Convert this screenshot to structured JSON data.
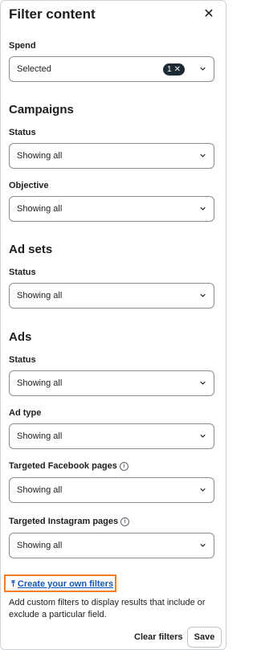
{
  "header": {
    "title": "Filter content",
    "close_glyph": "✕"
  },
  "spend": {
    "label": "Spend",
    "value": "Selected",
    "badge_count": "1"
  },
  "campaigns": {
    "title": "Campaigns",
    "status": {
      "label": "Status",
      "value": "Showing all"
    },
    "objective": {
      "label": "Objective",
      "value": "Showing all"
    }
  },
  "adsets": {
    "title": "Ad sets",
    "status": {
      "label": "Status",
      "value": "Showing all"
    }
  },
  "ads": {
    "title": "Ads",
    "status": {
      "label": "Status",
      "value": "Showing all"
    },
    "ad_type": {
      "label": "Ad type",
      "value": "Showing all"
    },
    "fb_pages": {
      "label": "Targeted Facebook pages",
      "value": "Showing all"
    },
    "ig_pages": {
      "label": "Targeted Instagram pages",
      "value": "Showing all"
    }
  },
  "custom": {
    "link": "Create your own filters",
    "description": "Add custom filters to display results that include or exclude a particular field."
  },
  "footer": {
    "clear": "Clear filters",
    "save": "Save"
  },
  "colors": {
    "link": "#1456b8",
    "highlight": "#f07d22",
    "badge": "#1c2b33"
  },
  "icons": {
    "info": "info-icon",
    "chevron": "chevron-down-icon",
    "close": "close-icon",
    "filter_link": "upload-icon"
  }
}
